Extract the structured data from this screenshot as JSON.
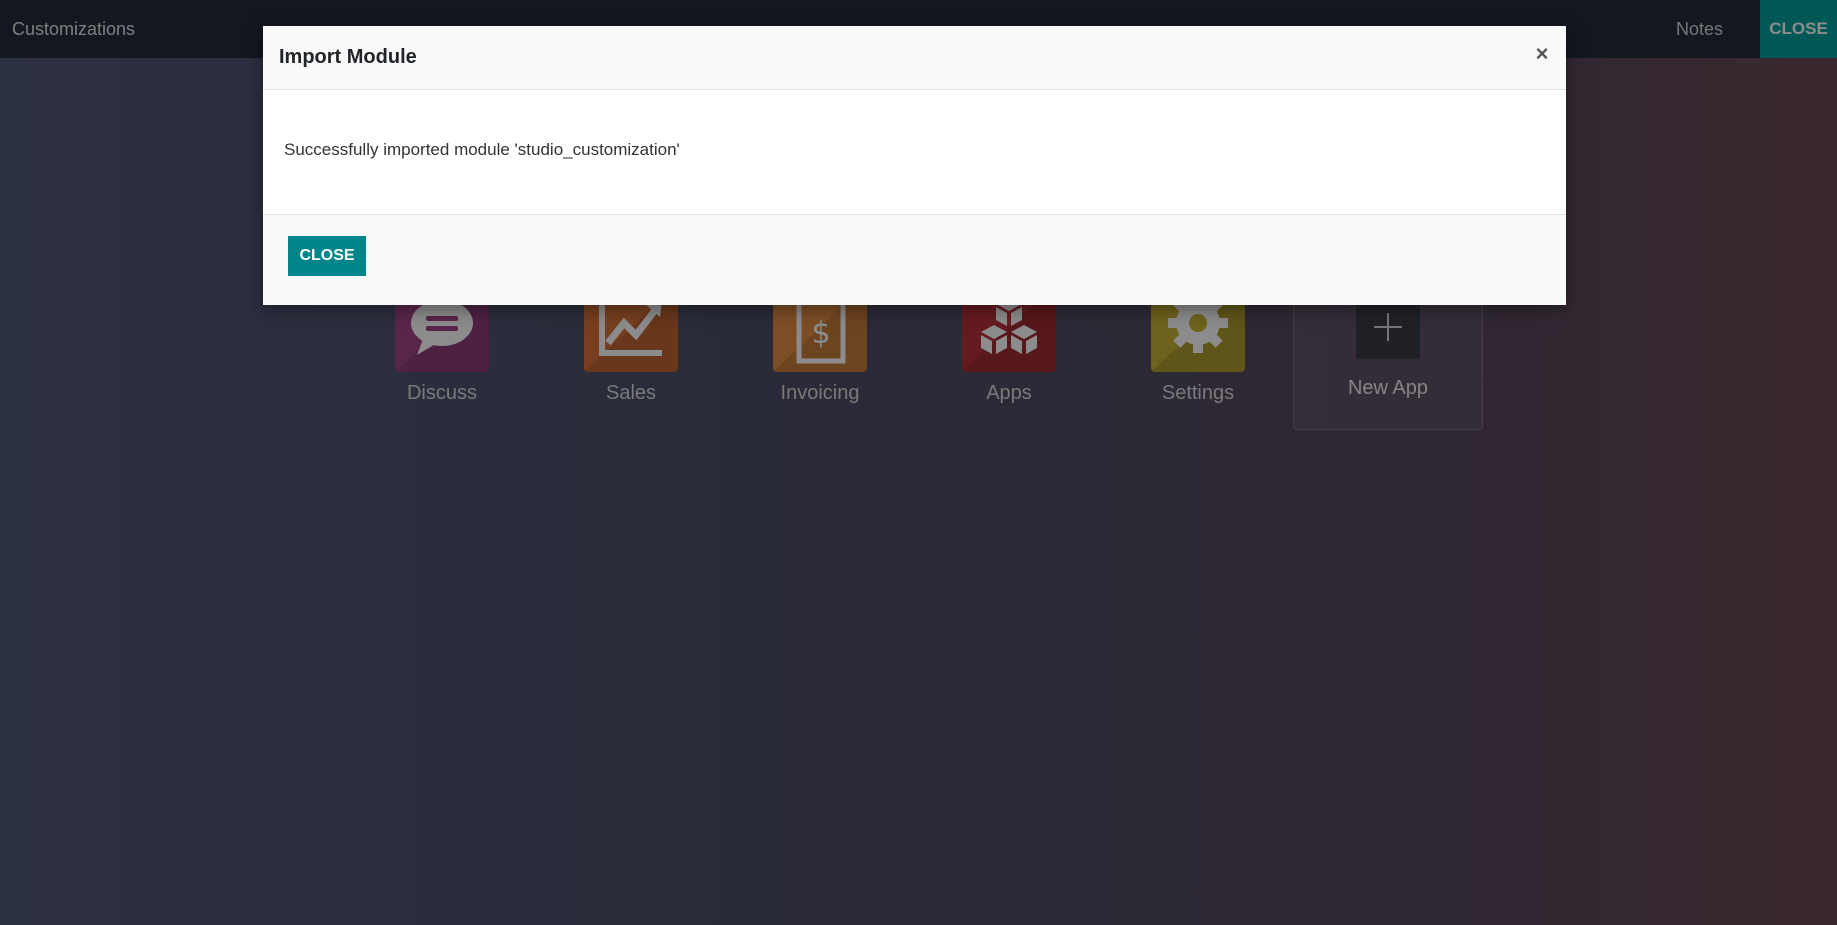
{
  "topbar": {
    "title": "Customizations",
    "notes_label": "Notes",
    "close_label": "CLOSE"
  },
  "apps": [
    {
      "label": "Discuss",
      "icon": "chat-bubble-icon",
      "color": "#a24689"
    },
    {
      "label": "Sales",
      "icon": "trend-chart-icon",
      "color": "#d9733b"
    },
    {
      "label": "Invoicing",
      "icon": "invoice-dollar-icon",
      "color": "#e38e44"
    },
    {
      "label": "Apps",
      "icon": "cubes-icon",
      "color": "#b8323a"
    },
    {
      "label": "Settings",
      "icon": "gear-icon",
      "color": "#c9b233"
    }
  ],
  "new_app": {
    "label": "New App",
    "icon": "plus-icon"
  },
  "modal": {
    "title": "Import Module",
    "close_x": "×",
    "message": "Successfully imported module 'studio_customization'",
    "close_button": "CLOSE"
  },
  "colors": {
    "accent": "#00858a",
    "topbar": "#222a3b"
  }
}
